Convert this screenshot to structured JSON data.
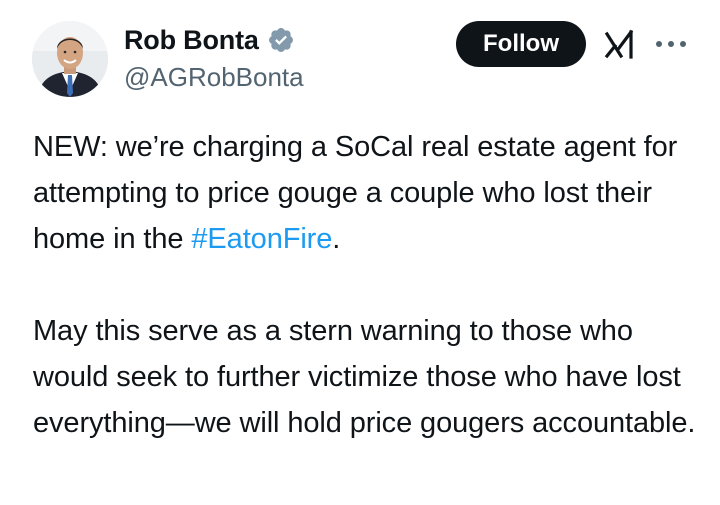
{
  "author": {
    "display_name": "Rob Bonta",
    "handle": "@AGRobBonta",
    "verified_icon": "verified-badge-icon",
    "avatar_icon": "avatar"
  },
  "actions": {
    "follow_label": "Follow",
    "grok_icon": "grok-icon",
    "more_icon": "more-icon"
  },
  "tweet": {
    "para1_before": "NEW: we’re charging a SoCal real estate agent for attempting to price gouge a couple who lost their home in the ",
    "hashtag": "#EatonFire",
    "para1_after": ".",
    "para2": "May this serve as a stern warning to those who would seek to further victimize those who have lost everything—we will hold price gougers accountable."
  },
  "colors": {
    "text": "#0f1419",
    "secondary_text": "#536471",
    "link": "#1d9bf0",
    "button_bg": "#0f1419",
    "verified": "#829aab"
  }
}
